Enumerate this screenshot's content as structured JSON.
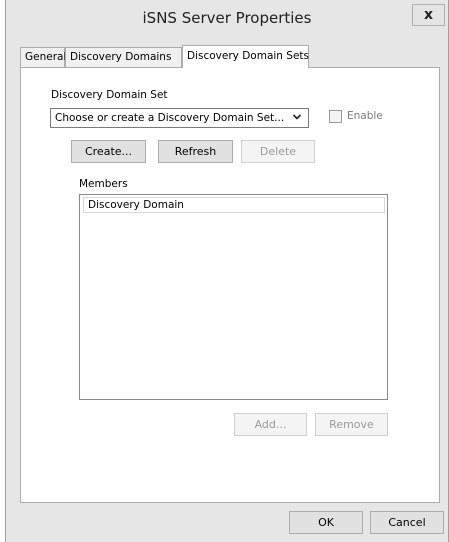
{
  "window": {
    "title": "iSNS Server Properties",
    "close_glyph": "x"
  },
  "tabs": [
    {
      "label": "General",
      "active": false
    },
    {
      "label": "Discovery Domains",
      "active": false
    },
    {
      "label": "Discovery Domain Sets",
      "active": true
    }
  ],
  "domain_set": {
    "label": "Discovery Domain Set",
    "combo_value": "Choose or create a Discovery Domain Set...",
    "enable_label": "Enable",
    "enable_checked": false
  },
  "buttons": {
    "create": "Create...",
    "refresh": "Refresh",
    "delete": "Delete",
    "add": "Add...",
    "remove": "Remove"
  },
  "members": {
    "label": "Members",
    "column_header": "Discovery Domain",
    "rows": []
  },
  "footer": {
    "ok": "OK",
    "cancel": "Cancel"
  },
  "colors": {
    "window_bg": "#e6e6e6",
    "panel_bg": "#ffffff",
    "button_bg": "#e1e1e1",
    "disabled_text": "#9a9a9a"
  },
  "icons": {
    "close": "close-icon",
    "dropdown": "chevron-down-icon"
  }
}
